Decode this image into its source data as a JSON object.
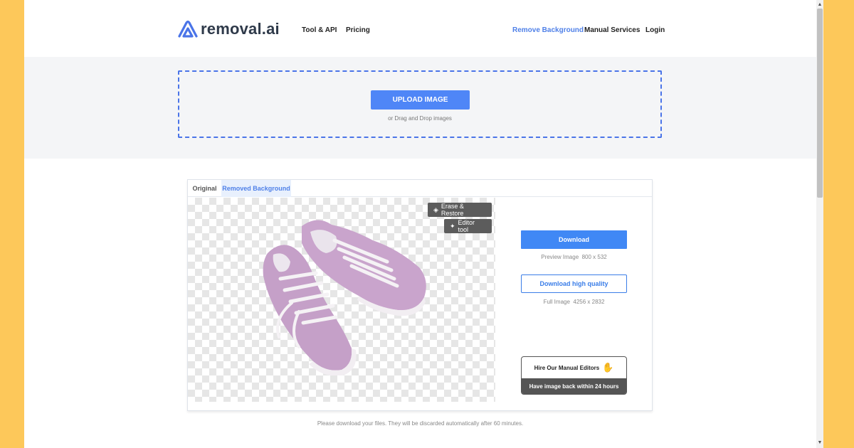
{
  "brand": {
    "name": "removal.ai",
    "accent": "#4f80e8"
  },
  "nav": {
    "left": [
      {
        "label": "Tool & API"
      },
      {
        "label": "Pricing"
      }
    ],
    "right": [
      {
        "label": "Remove Background",
        "active": true
      },
      {
        "label": "Manual Services"
      },
      {
        "label": "Login"
      }
    ]
  },
  "upload": {
    "button_label": "UPLOAD IMAGE",
    "hint": "or Drag and Drop images"
  },
  "result": {
    "tabs": [
      {
        "label": "Original",
        "active": false
      },
      {
        "label": "Removed Background",
        "active": true
      }
    ],
    "tools": {
      "erase_label": "Erase & Restore",
      "editor_label": "Editor tool"
    },
    "download": {
      "label": "Download",
      "meta_label": "Preview Image",
      "meta_size": "800 x 532"
    },
    "download_hq": {
      "label": "Download high quality",
      "meta_label": "Full Image",
      "meta_size": "4256 x 2832"
    },
    "hire": {
      "title": "Hire Our Manual Editors",
      "subtitle": "Have image back within 24 hours"
    }
  },
  "footer_note": "Please download your files. They will be discarded automatically after 60 minutes.",
  "icons": {
    "erase": "eraser-icon",
    "editor": "magic-wand-icon",
    "hire": "waving-hand-icon"
  }
}
